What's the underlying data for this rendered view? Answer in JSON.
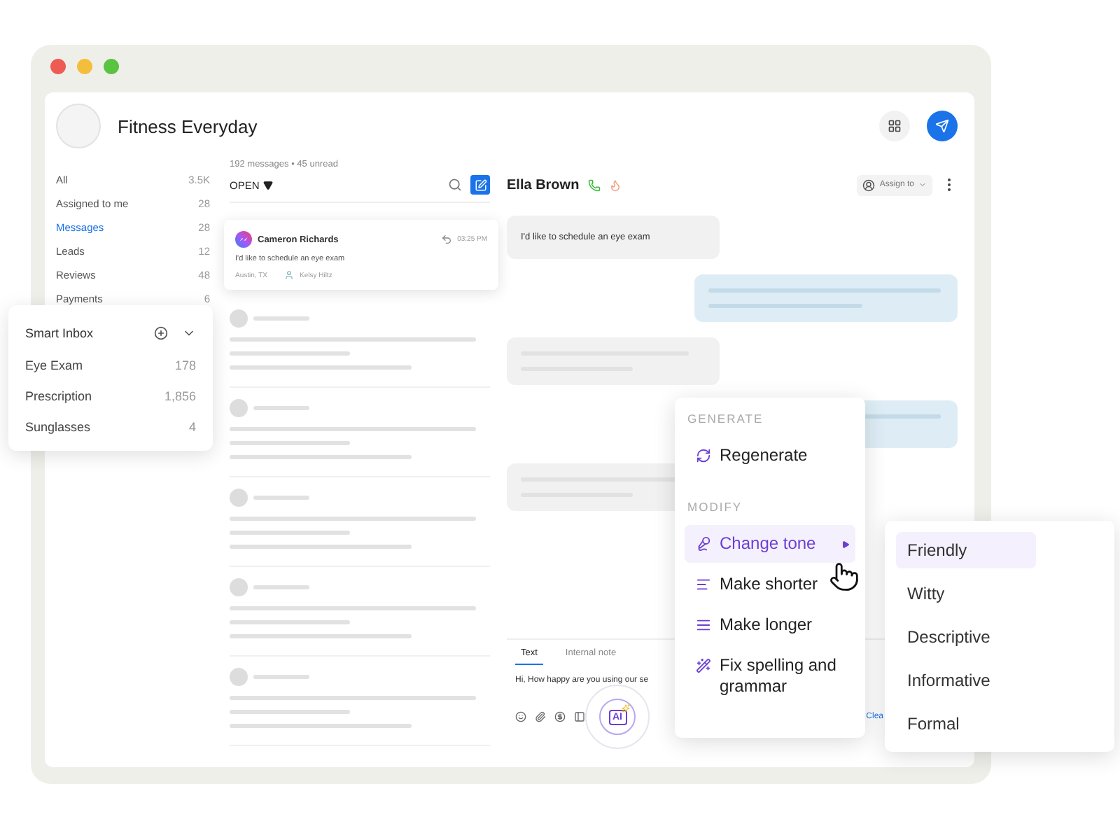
{
  "window": {
    "title": "Fitness Everyday"
  },
  "sidebar": {
    "items": [
      {
        "label": "All",
        "count": "3.5K",
        "selected": false
      },
      {
        "label": "Assigned to me",
        "count": "28",
        "selected": false
      },
      {
        "label": "Messages",
        "count": "28",
        "selected": true
      },
      {
        "label": "Leads",
        "count": "12",
        "selected": false
      },
      {
        "label": "Reviews",
        "count": "48",
        "selected": false
      },
      {
        "label": "Payments",
        "count": "6",
        "selected": false
      }
    ]
  },
  "message_list": {
    "summary": "192 messages • 45 unread",
    "filter": "OPEN",
    "cards": [
      {
        "name": "Cameron Richards",
        "time": "03:25 PM",
        "preview": "I'd like to schedule an eye exam",
        "location": "Austin, TX",
        "assignee": "Kelsy Hiltz"
      }
    ]
  },
  "smart_inbox": {
    "title": "Smart Inbox",
    "items": [
      {
        "label": "Eye Exam",
        "count": "178"
      },
      {
        "label": "Prescription",
        "count": "1,856"
      },
      {
        "label": "Sunglasses",
        "count": "4"
      }
    ]
  },
  "conversation": {
    "contact": "Ella Brown",
    "assign_label": "Assign to",
    "messages": [
      {
        "kind": "incoming",
        "text": "I'd like to schedule an eye exam"
      },
      {
        "kind": "outgoing"
      },
      {
        "kind": "incoming"
      },
      {
        "kind": "outgoing"
      },
      {
        "kind": "incoming"
      }
    ]
  },
  "composer": {
    "tabs": [
      {
        "label": "Text",
        "selected": true
      },
      {
        "label": "Internal note",
        "selected": false
      }
    ],
    "text": "Hi, How happy are you using our se",
    "link": "Clea",
    "ai_label": "AI"
  },
  "ai_menu": {
    "sections": [
      {
        "heading": "GENERATE",
        "items": [
          {
            "kind": "regenerate",
            "label": "Regenerate",
            "selected": false,
            "submenu": false
          }
        ]
      },
      {
        "heading": "MODIFY",
        "items": [
          {
            "kind": "tone",
            "label": "Change tone",
            "selected": true,
            "submenu": true
          },
          {
            "kind": "shorter",
            "label": "Make shorter",
            "selected": false,
            "submenu": false
          },
          {
            "kind": "longer",
            "label": "Make longer",
            "selected": false,
            "submenu": false
          },
          {
            "kind": "spelling",
            "label": "Fix spelling and grammar",
            "selected": false,
            "submenu": false
          }
        ]
      }
    ]
  },
  "tone_menu": {
    "items": [
      {
        "label": "Friendly",
        "selected": true
      },
      {
        "label": "Witty",
        "selected": false
      },
      {
        "label": "Descriptive",
        "selected": false
      },
      {
        "label": "Informative",
        "selected": false
      },
      {
        "label": "Formal",
        "selected": false
      }
    ]
  }
}
